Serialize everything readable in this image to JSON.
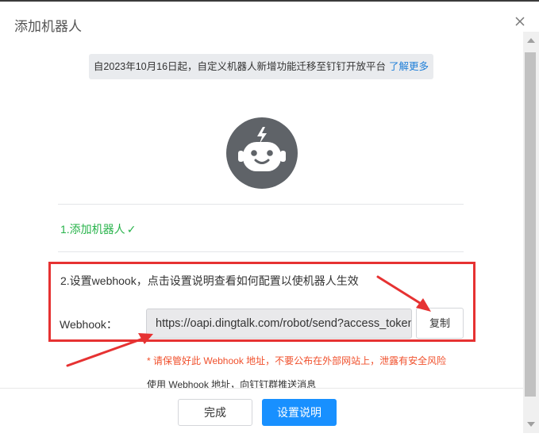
{
  "dialog": {
    "title": "添加机器人",
    "notice_text": "自2023年10月16日起，自定义机器人新增功能迁移至钉钉开放平台",
    "notice_link": "了解更多",
    "step1_label": "1.添加机器人",
    "step1_check": "✓",
    "step2_label": "2.设置webhook，点击设置说明查看如何配置以使机器人生效",
    "webhook_label": "Webhook：",
    "webhook_value": "https://oapi.dingtalk.com/robot/send?access_token=",
    "copy_label": "复制",
    "warning_text": "* 请保管好此 Webhook 地址，不要公布在外部网站上，泄露有安全风险",
    "usage_text": "使用 Webhook 地址，向钉钉群推送消息",
    "done_label": "完成",
    "help_label": "设置说明"
  },
  "icons": [
    "close-icon",
    "robot-avatar-icon",
    "check-icon",
    "scroll-up-icon",
    "scroll-down-icon"
  ],
  "colors": {
    "accent": "#1890ff",
    "success": "#27b34a",
    "warning": "#f0502c",
    "annotation": "#e63232",
    "avatar": "#5f6368"
  }
}
